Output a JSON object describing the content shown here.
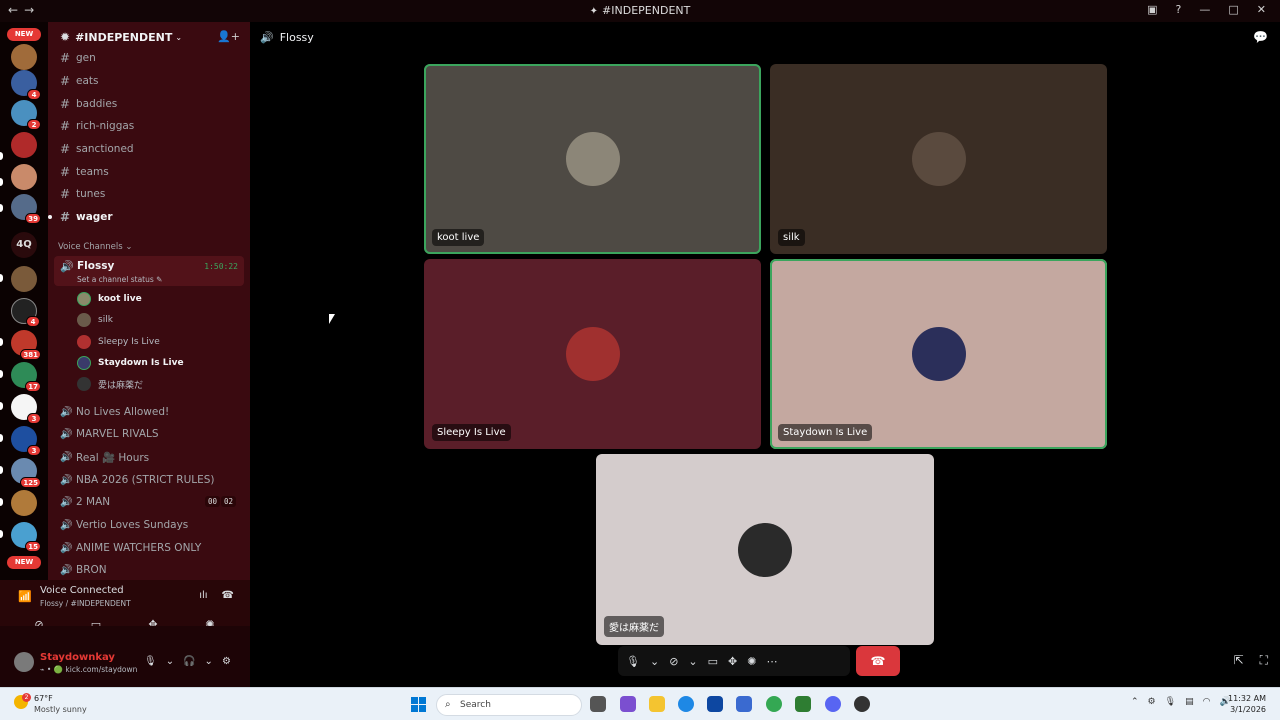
{
  "window": {
    "title": "#INDEPENDENT",
    "nav_back": "←",
    "nav_forward": "→",
    "title_icon": "✦",
    "right_icons": [
      "▣",
      "?",
      "—",
      "□",
      "✕"
    ]
  },
  "rail": {
    "new_top": "NEW",
    "new_bottom": "NEW",
    "text_server": "4Q",
    "badges": [
      "4",
      "2",
      "39",
      "4",
      "381",
      "17",
      "3",
      "3",
      "125",
      "15"
    ]
  },
  "server": {
    "name": "#INDEPENDENT",
    "chevron": "⌄",
    "invite_icon": "👤+"
  },
  "channels": [
    {
      "name": "gen",
      "bold": false
    },
    {
      "name": "eats",
      "bold": false
    },
    {
      "name": "baddies",
      "bold": false
    },
    {
      "name": "rich-niggas",
      "bold": false
    },
    {
      "name": "sanctioned",
      "bold": false
    },
    {
      "name": "teams",
      "bold": false
    },
    {
      "name": "tunes",
      "bold": false
    },
    {
      "name": "wager",
      "bold": true
    }
  ],
  "category": "Voice Channels ⌄",
  "active_voice": {
    "name": "Flossy",
    "timer": "1:50:22",
    "status": "Set a channel status ✎"
  },
  "members": [
    {
      "name": "koot live",
      "live": true
    },
    {
      "name": "silk",
      "live": false
    },
    {
      "name": "Sleepy Is Live",
      "live": false
    },
    {
      "name": "Staydown Is Live",
      "live": true
    },
    {
      "name": "愛は麻薬だ",
      "live": false
    }
  ],
  "voice_channels": [
    {
      "name": "No Lives Allowed!"
    },
    {
      "name": "MARVEL RIVALS"
    },
    {
      "name": "Real 🎥 Hours"
    },
    {
      "name": "NBA 2026 (STRICT RULES)"
    },
    {
      "name": "2 MAN",
      "count_a": "00",
      "count_b": "02"
    },
    {
      "name": "Vertio Loves Sundays"
    },
    {
      "name": "ANIME WATCHERS ONLY"
    },
    {
      "name": "BRON"
    }
  ],
  "voice_panel": {
    "title": "Voice Connected",
    "sub": "Flossy / #INDEPENDENT"
  },
  "user": {
    "name": "Staydownkay",
    "sub": "⌁ • 🟢 kick.com/staydown"
  },
  "main": {
    "channel_title": "Flossy"
  },
  "tiles": [
    {
      "label": "koot live"
    },
    {
      "label": "silk"
    },
    {
      "label": "Sleepy Is Live"
    },
    {
      "label": "Staydown Is Live"
    },
    {
      "label": "愛は麻薬だ"
    }
  ],
  "taskbar": {
    "temp": "67°F",
    "weather": "Mostly sunny",
    "weather_badge": "2",
    "search": "Search",
    "time": "11:32 AM",
    "date": "3/1/2026"
  }
}
